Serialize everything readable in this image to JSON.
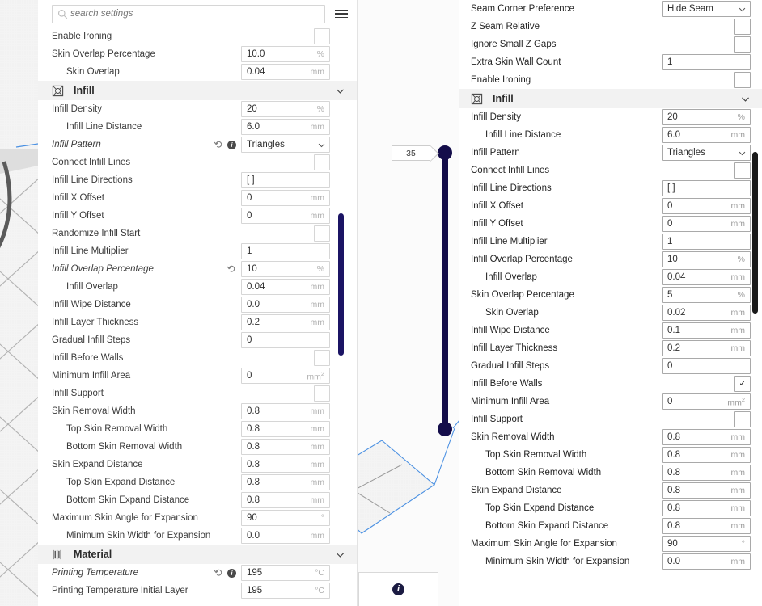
{
  "search": {
    "placeholder": "search settings",
    "value": "",
    "icon": "search-icon",
    "menu_icon": "hamburger-menu-icon"
  },
  "viewport": {
    "layer_slider": {
      "value": "35",
      "min_handle": "bottom-handle",
      "max_handle": "top-handle"
    },
    "info_badge": "i"
  },
  "left_panel": {
    "rows": [
      {
        "type": "setting",
        "label": "Enable Ironing",
        "indent": 0,
        "ctl": "checkbox",
        "checked": false
      },
      {
        "type": "setting",
        "label": "Skin Overlap Percentage",
        "indent": 0,
        "ctl": "text",
        "value": "10.0",
        "unit": "%"
      },
      {
        "type": "setting",
        "label": "Skin Overlap",
        "indent": 1,
        "ctl": "text",
        "value": "0.04",
        "unit": "mm"
      },
      {
        "type": "section",
        "label": "Infill",
        "icon": "infill-icon",
        "expanded": true
      },
      {
        "type": "setting",
        "label": "Infill Density",
        "indent": 0,
        "ctl": "text",
        "value": "20",
        "unit": "%"
      },
      {
        "type": "setting",
        "label": "Infill Line Distance",
        "indent": 1,
        "ctl": "text",
        "value": "6.0",
        "unit": "mm"
      },
      {
        "type": "setting",
        "label": "Infill Pattern",
        "indent": 0,
        "ctl": "select",
        "value": "Triangles",
        "modified": true,
        "revert": true,
        "info": true
      },
      {
        "type": "setting",
        "label": "Connect Infill Lines",
        "indent": 0,
        "ctl": "checkbox",
        "checked": false
      },
      {
        "type": "setting",
        "label": "Infill Line Directions",
        "indent": 0,
        "ctl": "text",
        "value": "[ ]",
        "unit": ""
      },
      {
        "type": "setting",
        "label": "Infill X Offset",
        "indent": 0,
        "ctl": "text",
        "value": "0",
        "unit": "mm"
      },
      {
        "type": "setting",
        "label": "Infill Y Offset",
        "indent": 0,
        "ctl": "text",
        "value": "0",
        "unit": "mm"
      },
      {
        "type": "setting",
        "label": "Randomize Infill Start",
        "indent": 0,
        "ctl": "checkbox",
        "checked": false
      },
      {
        "type": "setting",
        "label": "Infill Line Multiplier",
        "indent": 0,
        "ctl": "text",
        "value": "1",
        "unit": ""
      },
      {
        "type": "setting",
        "label": "Infill Overlap Percentage",
        "indent": 0,
        "ctl": "text",
        "value": "10",
        "unit": "%",
        "modified": true,
        "revert": true
      },
      {
        "type": "setting",
        "label": "Infill Overlap",
        "indent": 1,
        "ctl": "text",
        "value": "0.04",
        "unit": "mm"
      },
      {
        "type": "setting",
        "label": "Infill Wipe Distance",
        "indent": 0,
        "ctl": "text",
        "value": "0.0",
        "unit": "mm"
      },
      {
        "type": "setting",
        "label": "Infill Layer Thickness",
        "indent": 0,
        "ctl": "text",
        "value": "0.2",
        "unit": "mm"
      },
      {
        "type": "setting",
        "label": "Gradual Infill Steps",
        "indent": 0,
        "ctl": "text",
        "value": "0",
        "unit": ""
      },
      {
        "type": "setting",
        "label": "Infill Before Walls",
        "indent": 0,
        "ctl": "checkbox",
        "checked": false
      },
      {
        "type": "setting",
        "label": "Minimum Infill Area",
        "indent": 0,
        "ctl": "text",
        "value": "0",
        "unit": "mm",
        "unit_sup": "2"
      },
      {
        "type": "setting",
        "label": "Infill Support",
        "indent": 0,
        "ctl": "checkbox",
        "checked": false
      },
      {
        "type": "setting",
        "label": "Skin Removal Width",
        "indent": 0,
        "ctl": "text",
        "value": "0.8",
        "unit": "mm"
      },
      {
        "type": "setting",
        "label": "Top Skin Removal Width",
        "indent": 1,
        "ctl": "text",
        "value": "0.8",
        "unit": "mm"
      },
      {
        "type": "setting",
        "label": "Bottom Skin Removal Width",
        "indent": 1,
        "ctl": "text",
        "value": "0.8",
        "unit": "mm"
      },
      {
        "type": "setting",
        "label": "Skin Expand Distance",
        "indent": 0,
        "ctl": "text",
        "value": "0.8",
        "unit": "mm"
      },
      {
        "type": "setting",
        "label": "Top Skin Expand Distance",
        "indent": 1,
        "ctl": "text",
        "value": "0.8",
        "unit": "mm"
      },
      {
        "type": "setting",
        "label": "Bottom Skin Expand Distance",
        "indent": 1,
        "ctl": "text",
        "value": "0.8",
        "unit": "mm"
      },
      {
        "type": "setting",
        "label": "Maximum Skin Angle for Expansion",
        "indent": 0,
        "ctl": "text",
        "value": "90",
        "unit": "°"
      },
      {
        "type": "setting",
        "label": "Minimum Skin Width for Expansion",
        "indent": 1,
        "ctl": "text",
        "value": "0.0",
        "unit": "mm"
      },
      {
        "type": "section",
        "label": "Material",
        "icon": "material-icon",
        "expanded": true
      },
      {
        "type": "setting",
        "label": "Printing Temperature",
        "indent": 0,
        "ctl": "text",
        "value": "195",
        "unit": "°C",
        "modified": true,
        "revert": true,
        "info": true
      },
      {
        "type": "setting",
        "label": "Printing Temperature Initial Layer",
        "indent": 0,
        "ctl": "text",
        "value": "195",
        "unit": "°C"
      }
    ]
  },
  "right_panel": {
    "rows": [
      {
        "type": "setting",
        "label": "Seam Corner Preference",
        "indent": 0,
        "ctl": "select",
        "value": "Hide Seam"
      },
      {
        "type": "setting",
        "label": "Z Seam Relative",
        "indent": 0,
        "ctl": "checkbox",
        "checked": false
      },
      {
        "type": "setting",
        "label": "Ignore Small Z Gaps",
        "indent": 0,
        "ctl": "checkbox",
        "checked": false
      },
      {
        "type": "setting",
        "label": "Extra Skin Wall Count",
        "indent": 0,
        "ctl": "text",
        "value": "1",
        "unit": ""
      },
      {
        "type": "setting",
        "label": "Enable Ironing",
        "indent": 0,
        "ctl": "checkbox",
        "checked": false
      },
      {
        "type": "section",
        "label": "Infill",
        "icon": "infill-icon",
        "expanded": true
      },
      {
        "type": "setting",
        "label": "Infill Density",
        "indent": 0,
        "ctl": "text",
        "value": "20",
        "unit": "%"
      },
      {
        "type": "setting",
        "label": "Infill Line Distance",
        "indent": 1,
        "ctl": "text",
        "value": "6.0",
        "unit": "mm"
      },
      {
        "type": "setting",
        "label": "Infill Pattern",
        "indent": 0,
        "ctl": "select",
        "value": "Triangles"
      },
      {
        "type": "setting",
        "label": "Connect Infill Lines",
        "indent": 0,
        "ctl": "checkbox",
        "checked": false
      },
      {
        "type": "setting",
        "label": "Infill Line Directions",
        "indent": 0,
        "ctl": "text",
        "value": "[ ]",
        "unit": ""
      },
      {
        "type": "setting",
        "label": "Infill X Offset",
        "indent": 0,
        "ctl": "text",
        "value": "0",
        "unit": "mm"
      },
      {
        "type": "setting",
        "label": "Infill Y Offset",
        "indent": 0,
        "ctl": "text",
        "value": "0",
        "unit": "mm"
      },
      {
        "type": "setting",
        "label": "Infill Line Multiplier",
        "indent": 0,
        "ctl": "text",
        "value": "1",
        "unit": ""
      },
      {
        "type": "setting",
        "label": "Infill Overlap Percentage",
        "indent": 0,
        "ctl": "text",
        "value": "10",
        "unit": "%"
      },
      {
        "type": "setting",
        "label": "Infill Overlap",
        "indent": 1,
        "ctl": "text",
        "value": "0.04",
        "unit": "mm"
      },
      {
        "type": "setting",
        "label": "Skin Overlap Percentage",
        "indent": 0,
        "ctl": "text",
        "value": "5",
        "unit": "%"
      },
      {
        "type": "setting",
        "label": "Skin Overlap",
        "indent": 1,
        "ctl": "text",
        "value": "0.02",
        "unit": "mm"
      },
      {
        "type": "setting",
        "label": "Infill Wipe Distance",
        "indent": 0,
        "ctl": "text",
        "value": "0.1",
        "unit": "mm"
      },
      {
        "type": "setting",
        "label": "Infill Layer Thickness",
        "indent": 0,
        "ctl": "text",
        "value": "0.2",
        "unit": "mm"
      },
      {
        "type": "setting",
        "label": "Gradual Infill Steps",
        "indent": 0,
        "ctl": "text",
        "value": "0",
        "unit": ""
      },
      {
        "type": "setting",
        "label": "Infill Before Walls",
        "indent": 0,
        "ctl": "checkbox",
        "checked": true
      },
      {
        "type": "setting",
        "label": "Minimum Infill Area",
        "indent": 0,
        "ctl": "text",
        "value": "0",
        "unit": "mm",
        "unit_sup": "2"
      },
      {
        "type": "setting",
        "label": "Infill Support",
        "indent": 0,
        "ctl": "checkbox",
        "checked": false
      },
      {
        "type": "setting",
        "label": "Skin Removal Width",
        "indent": 0,
        "ctl": "text",
        "value": "0.8",
        "unit": "mm"
      },
      {
        "type": "setting",
        "label": "Top Skin Removal Width",
        "indent": 1,
        "ctl": "text",
        "value": "0.8",
        "unit": "mm"
      },
      {
        "type": "setting",
        "label": "Bottom Skin Removal Width",
        "indent": 1,
        "ctl": "text",
        "value": "0.8",
        "unit": "mm"
      },
      {
        "type": "setting",
        "label": "Skin Expand Distance",
        "indent": 0,
        "ctl": "text",
        "value": "0.8",
        "unit": "mm"
      },
      {
        "type": "setting",
        "label": "Top Skin Expand Distance",
        "indent": 1,
        "ctl": "text",
        "value": "0.8",
        "unit": "mm"
      },
      {
        "type": "setting",
        "label": "Bottom Skin Expand Distance",
        "indent": 1,
        "ctl": "text",
        "value": "0.8",
        "unit": "mm"
      },
      {
        "type": "setting",
        "label": "Maximum Skin Angle for Expansion",
        "indent": 0,
        "ctl": "text",
        "value": "90",
        "unit": "°"
      },
      {
        "type": "setting",
        "label": "Minimum Skin Width for Expansion",
        "indent": 1,
        "ctl": "text",
        "value": "0.0",
        "unit": "mm"
      }
    ]
  },
  "colors": {
    "slider": "#140d4a",
    "scrollbar_left": "#1b1464",
    "scrollbar_right": "#1a1a1a",
    "section_bg": "#f2f2f2",
    "model_outline": "#4a90e2"
  }
}
